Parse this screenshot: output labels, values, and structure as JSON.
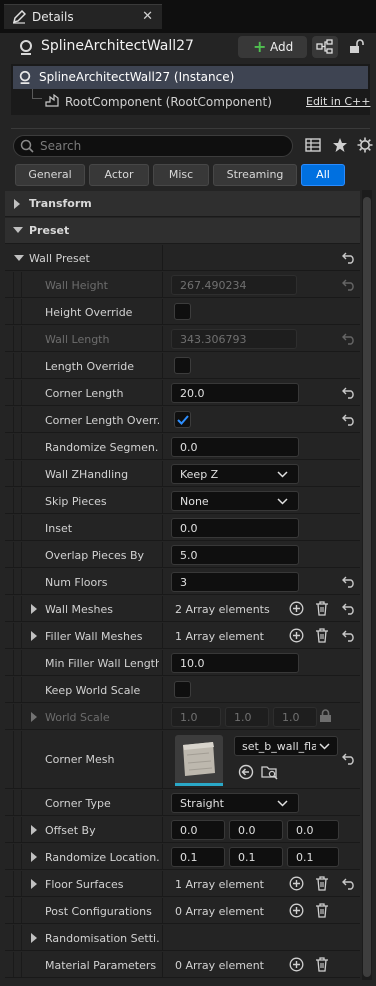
{
  "tab": {
    "title": "Details",
    "icon": "pencil-icon",
    "close": "✕"
  },
  "header": {
    "actor_name": "SplineArchitectWall27",
    "add_label": "Add"
  },
  "components": {
    "instance": "SplineArchitectWall27 (Instance)",
    "root": "RootComponent (RootComponent)",
    "edit_link": "Edit in C++"
  },
  "search": {
    "placeholder": "Search",
    "value": ""
  },
  "filters": [
    {
      "label": "General",
      "active": false
    },
    {
      "label": "Actor",
      "active": false
    },
    {
      "label": "Misc",
      "active": false
    },
    {
      "label": "Streaming",
      "active": false
    },
    {
      "label": "All",
      "active": true
    }
  ],
  "sections": {
    "transform": "Transform",
    "preset": "Preset",
    "wall_preset": "Wall Preset"
  },
  "properties": {
    "wall_height": {
      "label": "Wall Height",
      "value": "267.490234"
    },
    "height_override": {
      "label": "Height Override"
    },
    "wall_length": {
      "label": "Wall Length",
      "value": "343.306793"
    },
    "length_override": {
      "label": "Length Override"
    },
    "corner_length": {
      "label": "Corner Length",
      "value": "20.0"
    },
    "corner_length_override": {
      "label": "Corner Length Overr...",
      "checked": true
    },
    "randomize_segments": {
      "label": "Randomize Segmen...",
      "value": "0.0"
    },
    "wall_zhandling": {
      "label": "Wall ZHandling",
      "value": "Keep Z"
    },
    "skip_pieces": {
      "label": "Skip Pieces",
      "value": "None"
    },
    "inset": {
      "label": "Inset",
      "value": "0.0"
    },
    "overlap_pieces_by": {
      "label": "Overlap Pieces By",
      "value": "5.0"
    },
    "num_floors": {
      "label": "Num Floors",
      "value": "3"
    },
    "wall_meshes": {
      "label": "Wall Meshes",
      "value": "2 Array elements"
    },
    "filler_wall_meshes": {
      "label": "Filler Wall Meshes",
      "value": "1 Array element"
    },
    "min_filler_wall_length": {
      "label": "Min Filler Wall Length",
      "value": "10.0"
    },
    "keep_world_scale": {
      "label": "Keep World Scale"
    },
    "world_scale": {
      "label": "World Scale",
      "x": "1.0",
      "y": "1.0",
      "z": "1.0"
    },
    "corner_mesh": {
      "label": "Corner Mesh",
      "value": "set_b_wall_fla"
    },
    "corner_type": {
      "label": "Corner Type",
      "value": "Straight"
    },
    "offset_by": {
      "label": "Offset By",
      "x": "0.0",
      "y": "0.0",
      "z": "0.0"
    },
    "randomize_location": {
      "label": "Randomize Location...",
      "x": "0.1",
      "y": "0.1",
      "z": "0.1"
    },
    "floor_surfaces": {
      "label": "Floor Surfaces",
      "value": "1 Array element"
    },
    "post_configurations": {
      "label": "Post Configurations",
      "value": "0 Array element"
    },
    "randomisation_settings": {
      "label": "Randomisation Setti..."
    },
    "material_parameters": {
      "label": "Material Parameters",
      "value": "0 Array element"
    }
  },
  "colors": {
    "accent": "#0070e0",
    "background": "#242424",
    "add_green": "#50c050"
  }
}
